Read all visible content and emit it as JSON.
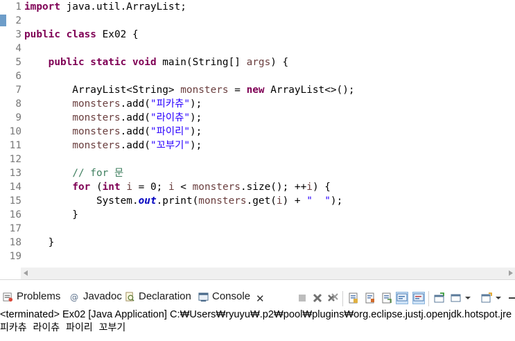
{
  "editor": {
    "lines": [
      {
        "n": "1",
        "tokens": [
          [
            "kw",
            "import"
          ],
          [
            "",
            " java.util.ArrayList;"
          ]
        ]
      },
      {
        "n": "2",
        "tokens": []
      },
      {
        "n": "3",
        "tokens": [
          [
            "kw",
            "public class"
          ],
          [
            "",
            " Ex02 {"
          ]
        ]
      },
      {
        "n": "4",
        "tokens": []
      },
      {
        "n": "5",
        "tokens": [
          [
            "",
            "    "
          ],
          [
            "kw",
            "public static void"
          ],
          [
            "",
            " main(String[] "
          ],
          [
            "var",
            "args"
          ],
          [
            "",
            ") {"
          ]
        ]
      },
      {
        "n": "6",
        "tokens": []
      },
      {
        "n": "7",
        "tokens": [
          [
            "",
            "        ArrayList<String> "
          ],
          [
            "var",
            "monsters"
          ],
          [
            "",
            " = "
          ],
          [
            "kw",
            "new"
          ],
          [
            "",
            " ArrayList<>();"
          ]
        ]
      },
      {
        "n": "8",
        "tokens": [
          [
            "",
            "        "
          ],
          [
            "var",
            "monsters"
          ],
          [
            "",
            ".add("
          ],
          [
            "str",
            "\"피카츄\""
          ],
          [
            "",
            ");"
          ]
        ]
      },
      {
        "n": "9",
        "tokens": [
          [
            "",
            "        "
          ],
          [
            "var",
            "monsters"
          ],
          [
            "",
            ".add("
          ],
          [
            "str",
            "\"라이츄\""
          ],
          [
            "",
            ");"
          ]
        ]
      },
      {
        "n": "10",
        "tokens": [
          [
            "",
            "        "
          ],
          [
            "var",
            "monsters"
          ],
          [
            "",
            ".add("
          ],
          [
            "str",
            "\"파이리\""
          ],
          [
            "",
            ");"
          ]
        ]
      },
      {
        "n": "11",
        "tokens": [
          [
            "",
            "        "
          ],
          [
            "var",
            "monsters"
          ],
          [
            "",
            ".add("
          ],
          [
            "str",
            "\"꼬부기\""
          ],
          [
            "",
            ");"
          ]
        ]
      },
      {
        "n": "12",
        "tokens": []
      },
      {
        "n": "13",
        "tokens": [
          [
            "",
            "        "
          ],
          [
            "cmt",
            "// for 문"
          ]
        ]
      },
      {
        "n": "14",
        "tokens": [
          [
            "",
            "        "
          ],
          [
            "kw",
            "for"
          ],
          [
            "",
            " ("
          ],
          [
            "kw",
            "int"
          ],
          [
            "",
            " "
          ],
          [
            "var",
            "i"
          ],
          [
            "",
            " = 0; "
          ],
          [
            "var",
            "i"
          ],
          [
            "",
            " < "
          ],
          [
            "var",
            "monsters"
          ],
          [
            "",
            ".size(); ++"
          ],
          [
            "var",
            "i"
          ],
          [
            "",
            ") {"
          ]
        ]
      },
      {
        "n": "15",
        "tokens": [
          [
            "",
            "            System."
          ],
          [
            "fld",
            "out"
          ],
          [
            "",
            ".print("
          ],
          [
            "var",
            "monsters"
          ],
          [
            "",
            ".get("
          ],
          [
            "var",
            "i"
          ],
          [
            "",
            ") + "
          ],
          [
            "str",
            "\"  \""
          ],
          [
            "",
            ");"
          ]
        ]
      },
      {
        "n": "16",
        "tokens": [
          [
            "",
            "        }"
          ]
        ]
      },
      {
        "n": "17",
        "tokens": []
      },
      {
        "n": "18",
        "tokens": [
          [
            "",
            "    }"
          ]
        ]
      },
      {
        "n": "19",
        "tokens": []
      }
    ]
  },
  "views": {
    "tabs": [
      {
        "id": "problems",
        "label": "Problems",
        "icon": "problems-icon"
      },
      {
        "id": "javadoc",
        "label": "Javadoc",
        "icon": "javadoc-icon"
      },
      {
        "id": "declaration",
        "label": "Declaration",
        "icon": "declaration-icon"
      },
      {
        "id": "console",
        "label": "Console",
        "icon": "console-icon",
        "active": true
      }
    ],
    "close_glyph": "✕",
    "toolbar": [
      "terminate-icon",
      "remove-launch-icon",
      "remove-all-icon",
      "scroll-lock-icon",
      "word-wrap-icon",
      "show-on-output-icon",
      "show-on-error-icon",
      "pin-console-icon",
      "display-console-icon",
      "open-console-icon",
      "minimize-icon"
    ]
  },
  "console": {
    "header": "<terminated> Ex02 [Java Application] C:₩Users₩ryuyu₩.p2₩pool₩plugins₩org.eclipse.justj.openjdk.hotspot.jre",
    "output": "피카츄  라이츄  파이리  꼬부기"
  },
  "colors": {
    "keyword": "#7f0055",
    "local_variable": "#6a3e3e",
    "string": "#2a00ff",
    "comment": "#3f7f5f",
    "static_field": "#0000c0",
    "line_number": "#787878"
  }
}
